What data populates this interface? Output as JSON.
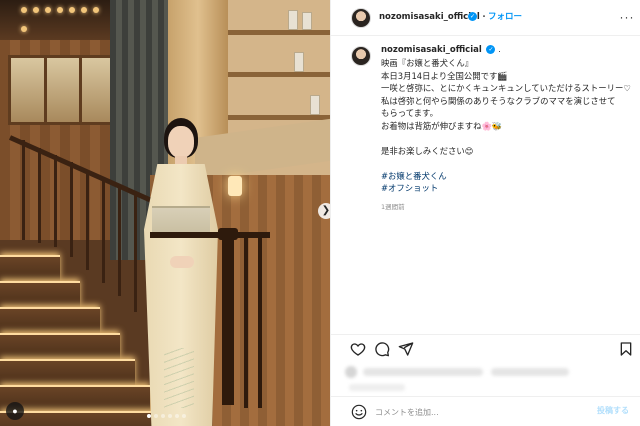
{
  "account": {
    "username": "nozomisasaki_official",
    "verified_icon": "verified-badge-icon",
    "separator": "・",
    "caption_separator": ".",
    "follow_label": "フォロー",
    "more_icon": "more-horizontal-icon"
  },
  "caption": {
    "lines": [
      "映画『お嬢と番犬くん』",
      "本日3月14日より全国公開です🎬",
      "一咲と啓弥に、とにかくキュンキュンしていただけるストーリー♡",
      "私は啓弥と何やら関係のありそうなクラブのママを演じさせて",
      "もらってます。",
      "お着物は背筋が伸びますね🌸🐝",
      "",
      "是非お楽しみください😊",
      ""
    ],
    "hashtags": [
      "#お嬢と番犬くん",
      "#オフショット"
    ],
    "timestamp": "1週間前"
  },
  "actions": {
    "like_icon": "heart-icon",
    "comment_icon": "comment-bubble-icon",
    "share_icon": "paper-plane-icon",
    "save_icon": "bookmark-icon"
  },
  "comment_box": {
    "emoji_icon": "smiley-face-icon",
    "placeholder": "コメントを追加...",
    "post_label": "投稿する"
  },
  "media": {
    "next_icon": "chevron-right-icon",
    "tag_icon": "user-tag-icon",
    "carousel_count": 6,
    "carousel_active": 1
  },
  "colors": {
    "accent": "#0095f6",
    "hashtag": "#00376b",
    "muted": "#8e8e8e",
    "post_disabled": "#b2dffc"
  }
}
